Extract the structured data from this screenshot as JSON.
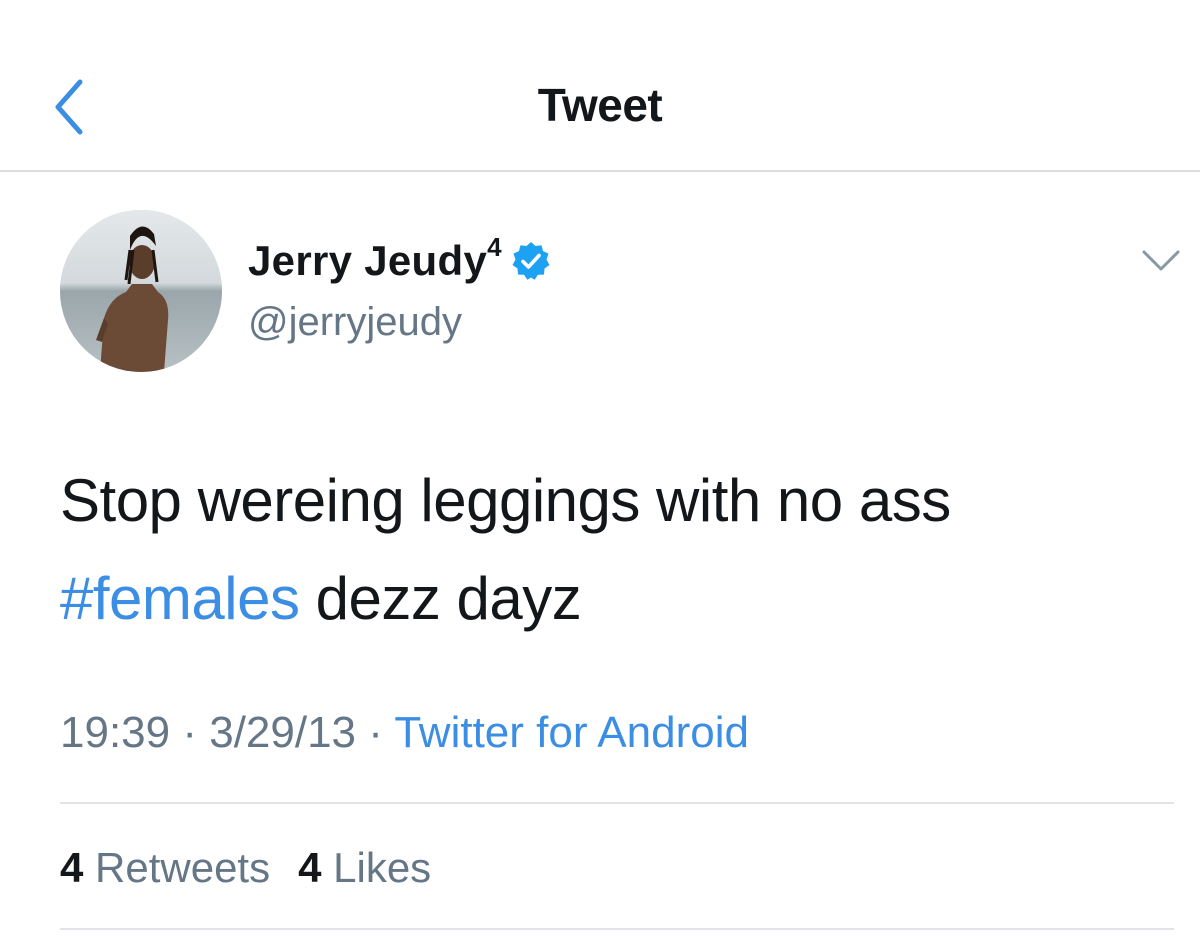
{
  "header": {
    "title": "Tweet"
  },
  "tweet": {
    "display_name": "Jerry Jeudy",
    "name_suffix": "4",
    "handle": "@jerryjeudy",
    "text_line1": "Stop wereing leggings with no ass",
    "hashtag": "#females",
    "text_line2_rest": " dezz dayz",
    "time": "19:39",
    "separator1": " · ",
    "date": "3/29/13",
    "separator2": " · ",
    "source": "Twitter for Android",
    "retweet_count": "4",
    "retweet_label": " Retweets",
    "like_count": "4",
    "like_label": " Likes"
  },
  "colors": {
    "accent": "#3b8ee3",
    "verified": "#1da1f2",
    "secondary_text": "#657786"
  }
}
